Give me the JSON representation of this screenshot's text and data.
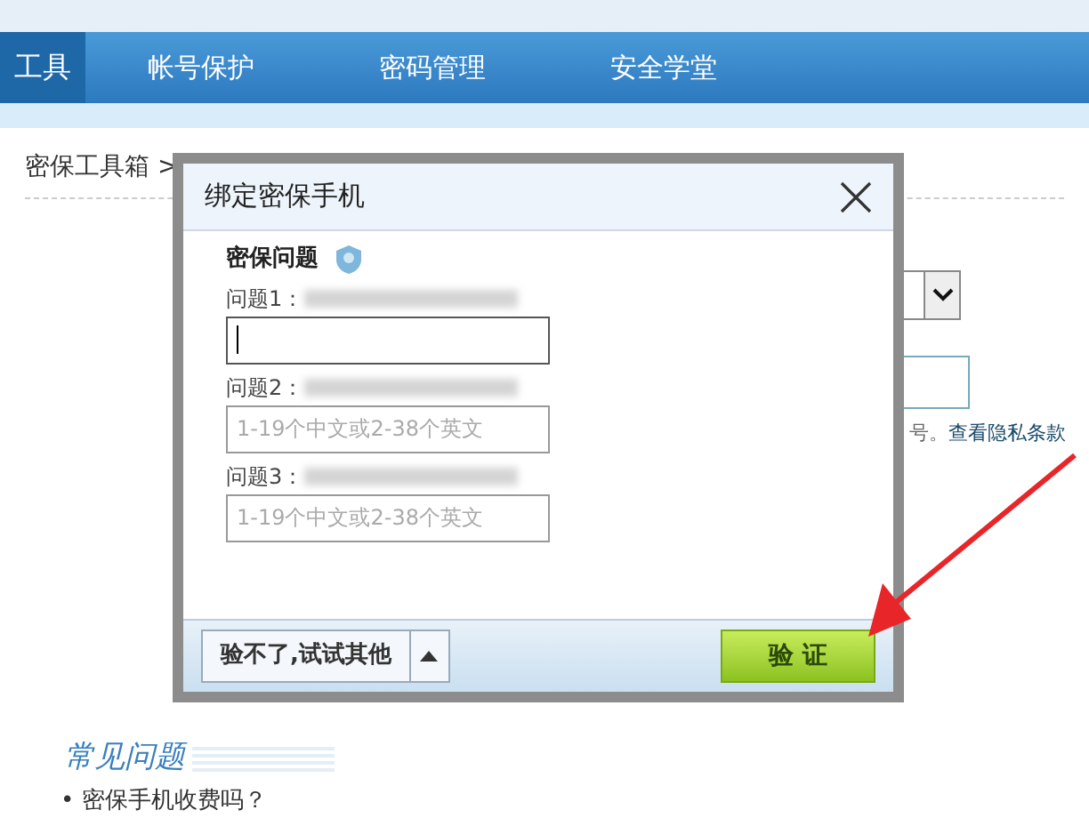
{
  "nav": {
    "items": [
      {
        "label": "工具",
        "selected": true
      },
      {
        "label": "帐号保护",
        "selected": false
      },
      {
        "label": "密码管理",
        "selected": false
      },
      {
        "label": "安全学堂",
        "selected": false
      }
    ]
  },
  "breadcrumb": "密保工具箱 >",
  "background_form": {
    "note": "号。",
    "link": "查看隐私条款"
  },
  "faq": {
    "title": "常见问题",
    "items": [
      "• 密保手机收费吗？"
    ]
  },
  "dialog": {
    "title": "绑定密保手机",
    "section": "密保问题",
    "questions": [
      {
        "label": "问题1：",
        "focused": true
      },
      {
        "label": "问题2：",
        "placeholder": "1-19个中文或2-38个英文",
        "focused": false
      },
      {
        "label": "问题3：",
        "placeholder": "1-19个中文或2-38个英文",
        "focused": false
      }
    ],
    "alt_button": "验不了,试试其他",
    "verify_button": "验 证"
  }
}
